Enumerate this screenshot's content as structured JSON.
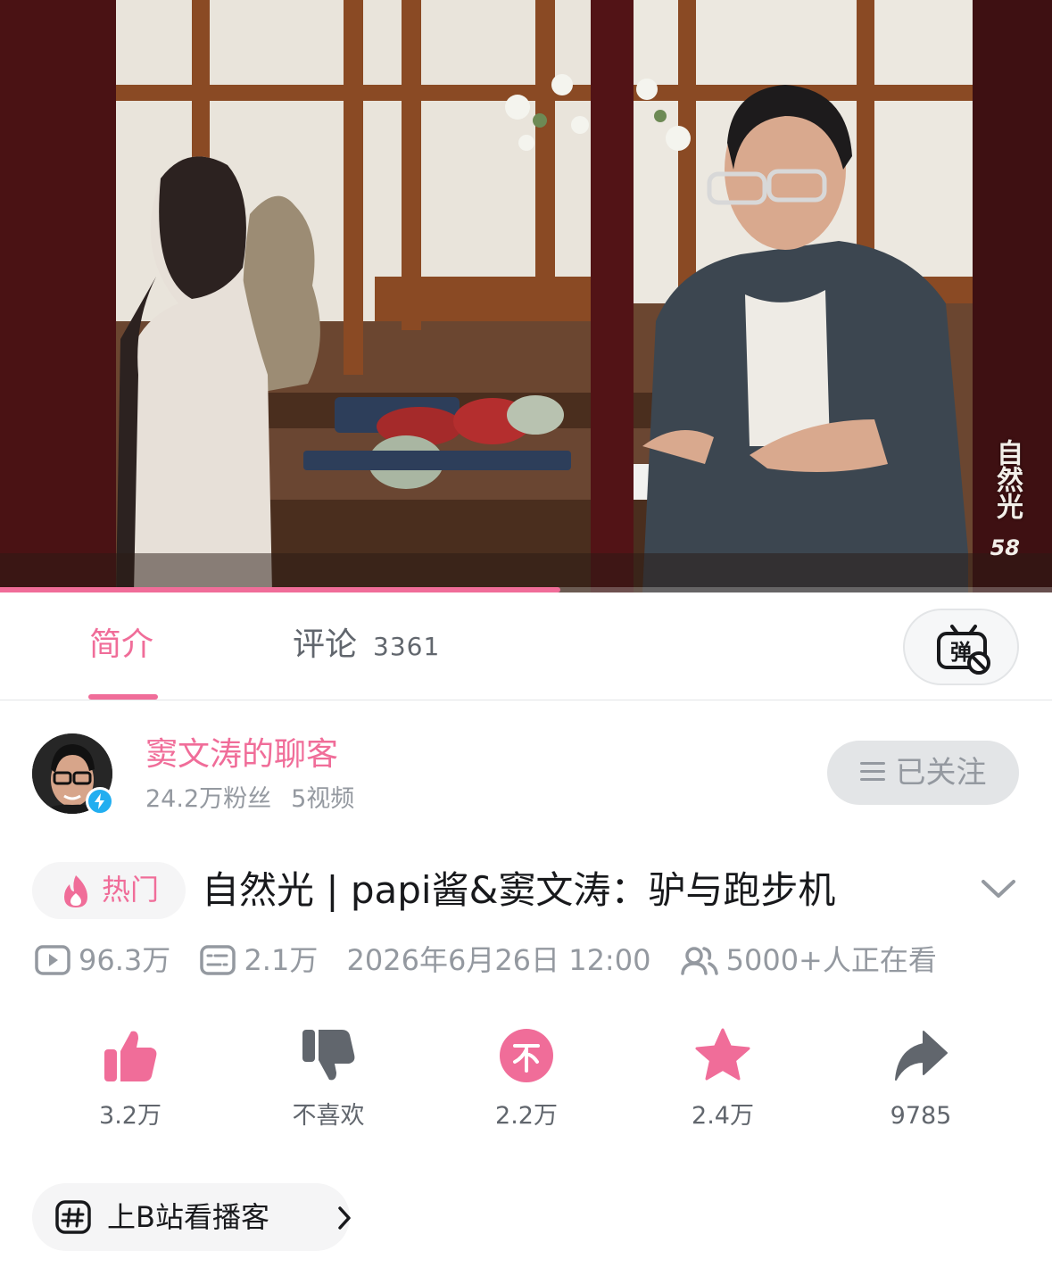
{
  "video": {
    "watermark_text": "自然光",
    "watermark_num": "58",
    "progress_fraction": 0.533
  },
  "tabs": {
    "intro_label": "简介",
    "comments_label": "评论",
    "comments_count": "3361",
    "danmaku_icon_text": "弹"
  },
  "uploader": {
    "name": "窦文涛的聊客",
    "followers": "24.2万粉丝",
    "videos": "5视频",
    "follow_label": "已关注"
  },
  "title": {
    "hot_label": "热门",
    "text": "自然光 | papi酱&窦文涛：驴与跑步机"
  },
  "meta": {
    "views": "96.3万",
    "danmaku": "2.1万",
    "date": "2026年6月26日 12:00",
    "watching": "5000+人正在看"
  },
  "actions": {
    "like": "3.2万",
    "dislike": "不喜欢",
    "coin": "2.2万",
    "favorite": "2.4万",
    "share": "9785"
  },
  "podcast": {
    "label": "上B站看播客"
  },
  "colors": {
    "accent_pink": "#f06d99",
    "text_gray": "#9499a0",
    "icon_dark": "#61666d"
  }
}
